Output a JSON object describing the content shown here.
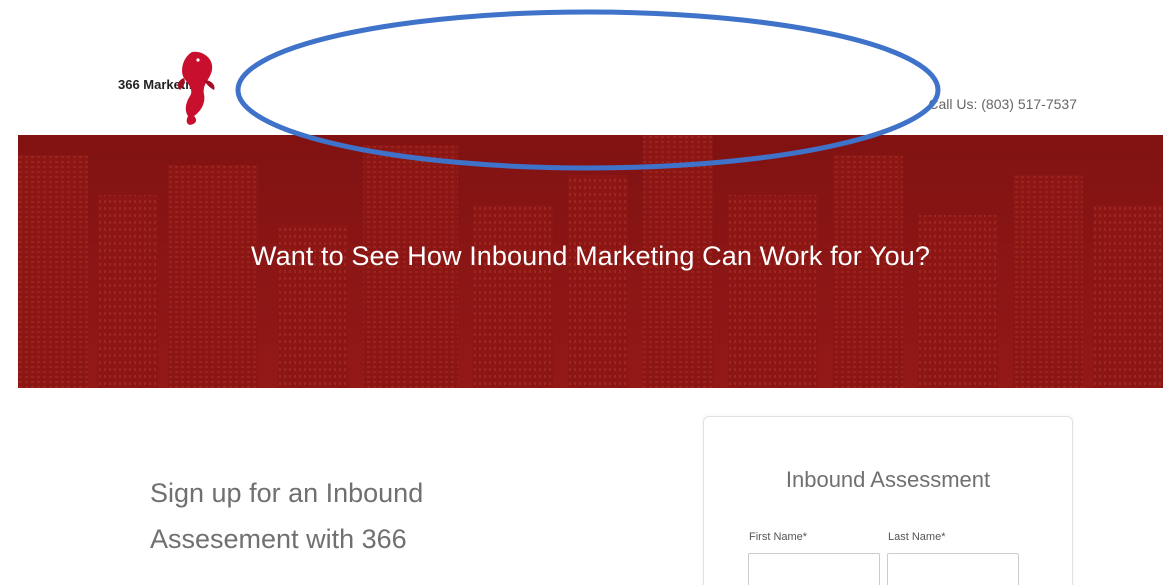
{
  "header": {
    "logo_text": "366 Marketing",
    "call_us": "Call Us: (803) 517-7537"
  },
  "hero": {
    "title": "Want to See How Inbound Marketing Can Work for You?"
  },
  "main": {
    "signup_line1": "Sign up for an Inbound",
    "signup_line2": "Assesement with 366"
  },
  "form": {
    "title": "Inbound Assessment",
    "first_name_label": "First Name*",
    "last_name_label": "Last Name*",
    "first_name_value": "",
    "last_name_value": ""
  },
  "colors": {
    "brand_red": "#8e1717",
    "annotation_blue": "#3f72c9",
    "logo_fish": "#c8102e"
  },
  "icons": {
    "logo": "koi-fish-icon"
  }
}
